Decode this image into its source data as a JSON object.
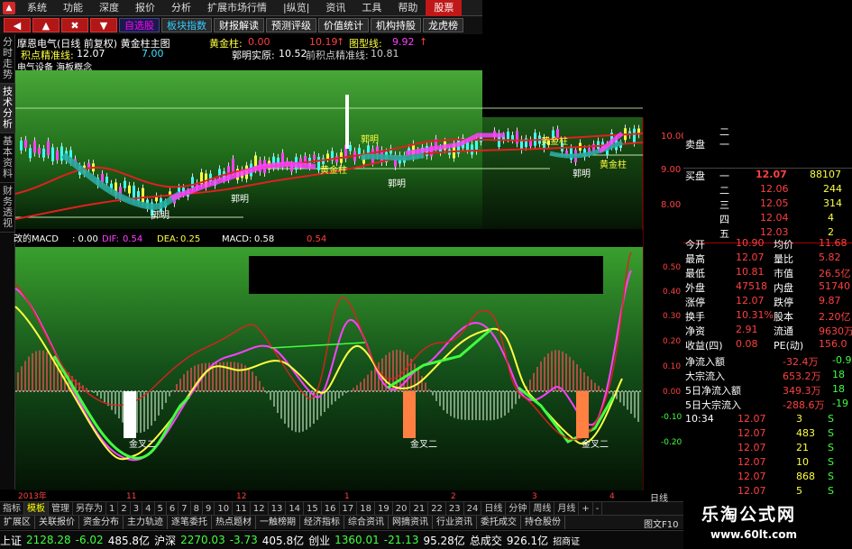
{
  "menu": {
    "items": [
      "系统",
      "功能",
      "深度",
      "报价",
      "分析",
      "扩展市场行情",
      "|纵览|",
      "资讯",
      "工具",
      "帮助"
    ],
    "hot": "股票"
  },
  "toolbar": {
    "red_buttons": [
      "◀",
      "▲",
      "✖",
      "▼"
    ],
    "buttons": [
      "自选股",
      "板块指数",
      "财报解读",
      "预测评级",
      "价值统计",
      "机构持股",
      "龙虎榜"
    ]
  },
  "vtabs": [
    "分时走势",
    "技术分析",
    "基本资料",
    "财务透视"
  ],
  "stock_info": {
    "name_line": "摩恩电气(日线 前复权) 黄金柱主图",
    "gold_label": "黄金柱:",
    "gold_value": "0.00",
    "v1": "10.19",
    "v1_arrow": "↑",
    "pattern_label": "图型线:",
    "pattern_value": "9.92",
    "pattern_arrow": "↑",
    "precise_label": "积点精准线:",
    "precise_value": "12.07",
    "v3": "7.00",
    "wang_label": "郭明实原:",
    "wang_value": "10.52",
    "prev_label": "前积点精准线:",
    "prev_value": "10.81",
    "sub_title": "电气设备 海板概念"
  },
  "chart_labels": {
    "gold_pillar": "黄金柱",
    "wang": "郭明",
    "cross2": "金叉二"
  },
  "macd_info": {
    "name": "改的MACD",
    "v0": ": 0.00",
    "dif_label": "DIF:",
    "dif": "0.54",
    "dea_label": "DEA:",
    "dea": "0.25",
    "macd_label": "MACD:",
    "macd": "0.58",
    "v5": "0.54"
  },
  "price_axis": [
    "10.00",
    "9.00",
    "8.00"
  ],
  "macd_axis": [
    "0.50",
    "0.40",
    "0.30",
    "0.20",
    "0.10",
    "0.00",
    "-0.10",
    "-0.20"
  ],
  "time_axis": [
    "2013年",
    "11",
    "12",
    "1",
    "2",
    "3",
    "4"
  ],
  "right_panel": {
    "sell_levels": [
      "二",
      "一"
    ],
    "sell_label": "卖盘",
    "buy_label": "买盘",
    "buy_levels": [
      {
        "label": "一",
        "price": "12.07",
        "vol": "88107"
      },
      {
        "label": "二",
        "price": "12.06",
        "vol": "244"
      },
      {
        "label": "三",
        "price": "12.05",
        "vol": "314"
      },
      {
        "label": "四",
        "price": "12.04",
        "vol": "4"
      },
      {
        "label": "五",
        "price": "12.03",
        "vol": "2"
      }
    ],
    "stats": [
      {
        "l1": "今开",
        "v1": "10.90",
        "l2": "均价",
        "v2": "11.68"
      },
      {
        "l1": "最高",
        "v1": "12.07",
        "l2": "量比",
        "v2": "5.82"
      },
      {
        "l1": "最低",
        "v1": "10.81",
        "l2": "市值",
        "v2": "26.5亿"
      },
      {
        "l1": "外盘",
        "v1": "47518",
        "l2": "内盘",
        "v2": "51740"
      },
      {
        "l1": "涨停",
        "v1": "12.07",
        "l2": "跌停",
        "v2": "9.87"
      },
      {
        "l1": "换手",
        "v1": "10.31%",
        "l2": "股本",
        "v2": "2.20亿"
      },
      {
        "l1": "净资",
        "v1": "2.91",
        "l2": "流通",
        "v2": "9630万"
      },
      {
        "l1": "收益(四)",
        "v1": "0.08",
        "l2": "PE(动)",
        "v2": "156.0"
      }
    ],
    "flows": [
      {
        "label": "净流入额",
        "v1": "-32.4万",
        "v2": "-0.9"
      },
      {
        "label": "大宗流入",
        "v1": "653.2万",
        "v2": "18"
      },
      {
        "label": "5日净流入额",
        "v1": "349.3万",
        "v2": "18"
      },
      {
        "label": "5日大宗流入",
        "v1": "-288.6万",
        "v2": "-19"
      }
    ],
    "ticks": [
      {
        "time": "10:34",
        "price": "12.07",
        "vol": "3",
        "dir": "S"
      },
      {
        "time": "",
        "price": "12.07",
        "vol": "483",
        "dir": "S"
      },
      {
        "time": "",
        "price": "12.07",
        "vol": "21",
        "dir": "S"
      },
      {
        "time": "",
        "price": "12.07",
        "vol": "10",
        "dir": "S"
      },
      {
        "time": "",
        "price": "12.07",
        "vol": "868",
        "dir": "S"
      },
      {
        "time": "",
        "price": "12.07",
        "vol": "5",
        "dir": "S"
      }
    ]
  },
  "tabbar": [
    "指标",
    "模板",
    "管理",
    "另存为",
    "1",
    "2",
    "3",
    "4",
    "5",
    "6",
    "7",
    "8",
    "9",
    "10",
    "11",
    "12",
    "13",
    "14",
    "15",
    "16",
    "17",
    "18",
    "19",
    "20",
    "21",
    "22",
    "23",
    "24",
    "日线",
    "分钟",
    "周线",
    "月线"
  ],
  "tabbar_extra": [
    "+",
    "-"
  ],
  "funcbar": [
    "扩展区",
    "关联报价",
    "资金分布",
    "主力轨迹",
    "逐笔委托",
    "热点题材",
    "一触榜期",
    "经济指标",
    "综合资讯",
    "网摘资讯",
    "行业资讯",
    "委托成交",
    "持仓股份"
  ],
  "status": {
    "sh_label": "上证",
    "sh_val": "2128.28",
    "sh_chg": "-6.02",
    "sh_amt": "485.8亿",
    "hs_label": "沪深",
    "hs_val": "2270.03",
    "hs_chg": "-3.73",
    "hs_amt": "405.8亿",
    "cy_label": "创业",
    "cy_val": "1360.01",
    "cy_chg": "-21.13",
    "cy_amt": "95.28亿",
    "total_label": "总成交",
    "total_amt": "926.1亿",
    "right_a": "招商证",
    "right_b": "图文F10",
    "right_c": "日线"
  },
  "watermark": {
    "title": "乐淘公式网",
    "url": "www.60lt.com"
  }
}
